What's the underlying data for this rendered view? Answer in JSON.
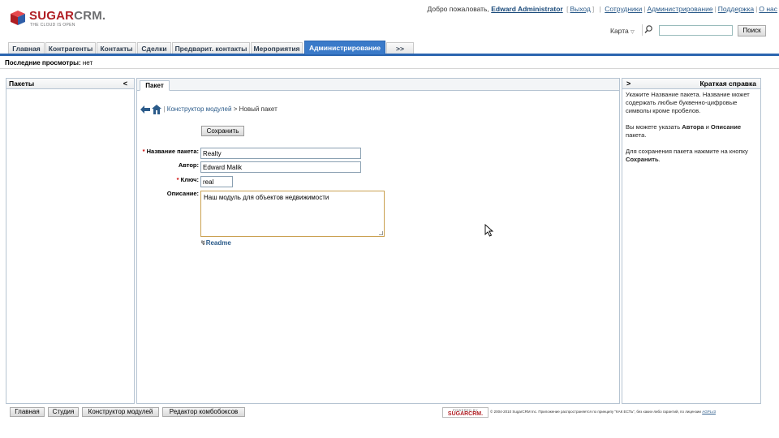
{
  "header": {
    "logo": {
      "word_sugar": "SUGAR",
      "word_crm": "CRM.",
      "tagline": "THE CLOUD IS OPEN"
    },
    "welcome_prefix": "Добро пожаловать,",
    "username": "Edward Administrator",
    "logout_label": "Выход",
    "links": [
      "Сотрудники",
      "Администрирование",
      "Поддержка",
      "О нас"
    ],
    "map_label": "Карта",
    "search_placeholder": "",
    "search_button": "Поиск"
  },
  "tabs": [
    {
      "label": "Главная",
      "active": false
    },
    {
      "label": "Контрагенты",
      "active": false
    },
    {
      "label": "Контакты",
      "active": false
    },
    {
      "label": "Сделки",
      "active": false
    },
    {
      "label": "Предварит. контакты",
      "active": false
    },
    {
      "label": "Мероприятия",
      "active": false
    },
    {
      "label": "Администрирование",
      "active": true
    },
    {
      "label": ">>",
      "active": false
    }
  ],
  "last_viewed": {
    "label": "Последние просмотры:",
    "value": "нет"
  },
  "left_panel": {
    "title": "Пакеты",
    "collapse_glyph": "<"
  },
  "center": {
    "tab_label": "Пакет",
    "breadcrumb_link": "Конструктор модулей",
    "breadcrumb_sep": " > ",
    "breadcrumb_current": "Новый пакет",
    "save_button": "Сохранить",
    "fields": {
      "package_name_label": "Название пакета:",
      "package_name_value": "Realty",
      "author_label": "Автор:",
      "author_value": "Edward Malik",
      "key_label": "Ключ:",
      "key_value": "real",
      "description_label": "Описание:",
      "description_value": "Наш модуль для объектов недвижимости"
    },
    "readme_label": "Readme"
  },
  "right_panel": {
    "expand_glyph": ">",
    "title": "Краткая справка",
    "p1": "Укажите Название пакета. Название может содержать любые буквенно-цифровые символы кроме пробелов.",
    "p2_a": "Вы можете указать ",
    "p2_author": "Автора",
    "p2_and": " и ",
    "p2_desc": "Описание",
    "p2_b": " пакета.",
    "p3_a": "Для сохранения пакета нажмите на кнопку ",
    "p3_save": "Сохранить",
    "p3_b": "."
  },
  "footer": {
    "buttons": [
      "Главная",
      "Студия",
      "Конструктор модулей",
      "Редактор комбобоксов"
    ],
    "powered_top": "POWERED BY",
    "powered_brand": "SUGARCRM.",
    "copyright": "© 2004-2010 SugarCRM Inc. Приложение распространяется по принципу \"КАК ЕСТЬ\", без каких-либо гарантий, по лицензии ",
    "license_link": "AGPLv3"
  },
  "colors": {
    "brand_red": "#b01e23",
    "tab_active": "#3a7ac9",
    "tab_underline": "#2b65b0",
    "link": "#2b5b8a"
  }
}
